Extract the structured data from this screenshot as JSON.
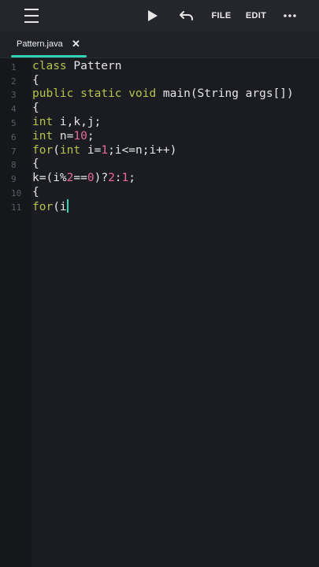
{
  "toolbar": {
    "file_label": "FILE",
    "edit_label": "EDIT",
    "icons": [
      "menu-icon",
      "play-icon",
      "undo-icon",
      "more-icon"
    ]
  },
  "tab": {
    "label": "Pattern.java",
    "close_glyph": "✕"
  },
  "editor": {
    "line_numbers": [
      "1",
      "2",
      "3",
      "4",
      "5",
      "6",
      "7",
      "8",
      "9",
      "10",
      "11"
    ],
    "lines": [
      "class Pattern",
      "{",
      "public static void main(String args[])",
      "{",
      "int i,k,j;",
      "int n=10;",
      "for(int i=1;i<=n;i++)",
      "{",
      "k=(i%2==0)?2:1;",
      "{",
      "for(i"
    ]
  },
  "colors": {
    "accent": "#31d4b4",
    "keyword": "#b6c34a",
    "number": "#e96b9a",
    "text": "#e6e6e6"
  }
}
